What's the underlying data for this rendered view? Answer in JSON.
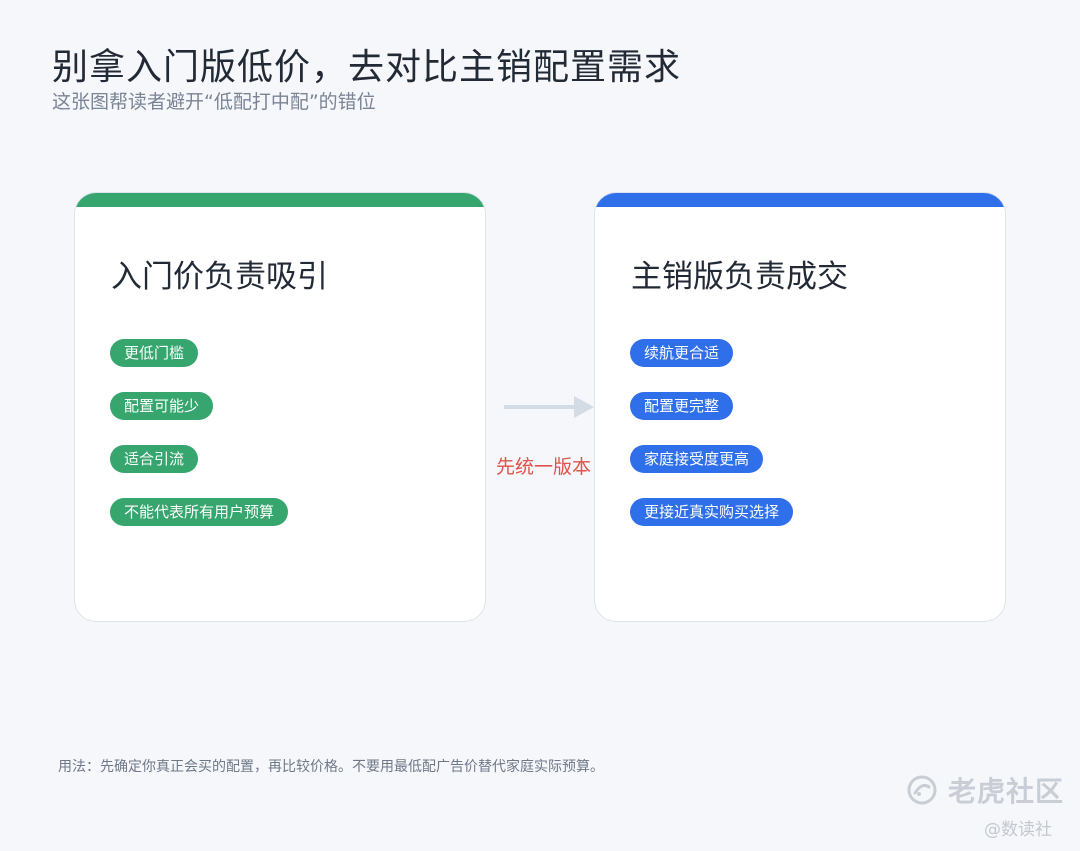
{
  "header": {
    "title": "别拿入门版低价，去对比主销配置需求",
    "subtitle": "这张图帮读者避开“低配打中配”的错位"
  },
  "colors": {
    "green": "#36a56e",
    "blue": "#2f6fea",
    "arrow": "#d3dbe5",
    "arrow_label": "#e0524a"
  },
  "left_card": {
    "title": "入门价负责吸引",
    "tags": [
      "更低门槛",
      "配置可能少",
      "适合引流",
      "不能代表所有用户预算"
    ]
  },
  "right_card": {
    "title": "主销版负责成交",
    "tags": [
      "续航更合适",
      "配置更完整",
      "家庭接受度更高",
      "更接近真实购买选择"
    ]
  },
  "connector": {
    "label": "先统一版本"
  },
  "footer": {
    "note": "用法：先确定你真正会买的配置，再比较价格。不要用最低配广告价替代家庭实际预算。"
  },
  "watermark": {
    "logo_text": "老虎社区",
    "sub_text": "@数读社"
  }
}
